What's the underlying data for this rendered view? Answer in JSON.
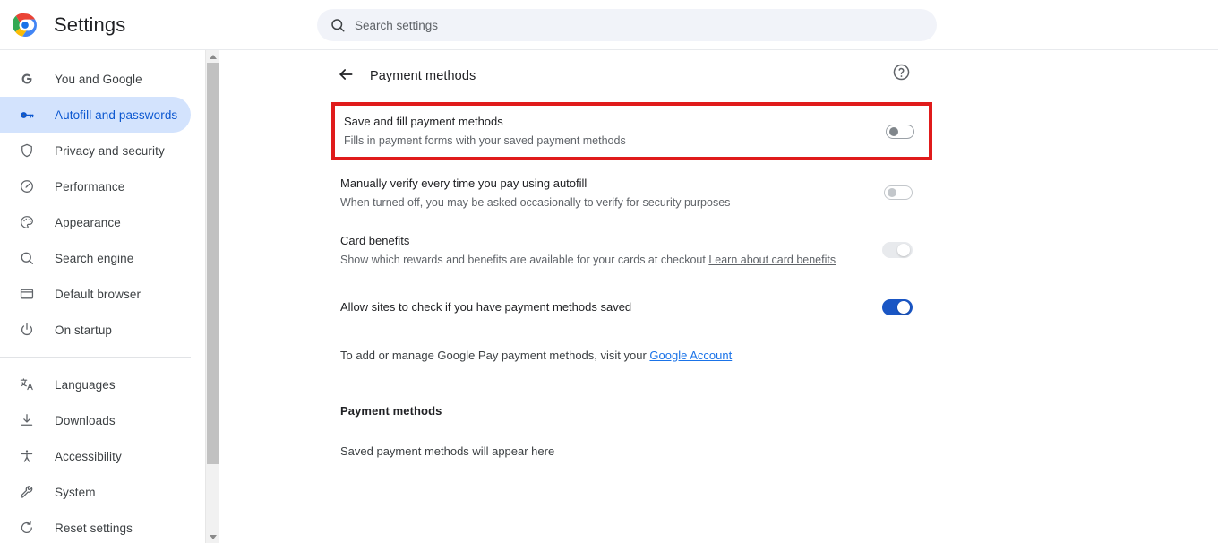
{
  "header": {
    "logo_icon": "chrome-logo-icon",
    "title": "Settings",
    "search": {
      "icon": "search-icon",
      "placeholder": "Search settings",
      "value": ""
    }
  },
  "sidebar": {
    "group1": [
      {
        "icon": "google-g-icon",
        "label": "You and Google",
        "active": false
      },
      {
        "icon": "key-icon",
        "label": "Autofill and passwords",
        "active": true
      },
      {
        "icon": "shield-icon",
        "label": "Privacy and security",
        "active": false
      },
      {
        "icon": "speedometer-icon",
        "label": "Performance",
        "active": false
      },
      {
        "icon": "palette-icon",
        "label": "Appearance",
        "active": false
      },
      {
        "icon": "search-icon",
        "label": "Search engine",
        "active": false
      },
      {
        "icon": "window-icon",
        "label": "Default browser",
        "active": false
      },
      {
        "icon": "power-icon",
        "label": "On startup",
        "active": false
      }
    ],
    "group2": [
      {
        "icon": "translate-icon",
        "label": "Languages",
        "active": false
      },
      {
        "icon": "download-icon",
        "label": "Downloads",
        "active": false
      },
      {
        "icon": "accessibility-icon",
        "label": "Accessibility",
        "active": false
      },
      {
        "icon": "wrench-icon",
        "label": "System",
        "active": false
      },
      {
        "icon": "restore-icon",
        "label": "Reset settings",
        "active": false
      }
    ]
  },
  "main": {
    "back_icon": "back-arrow-icon",
    "title": "Payment methods",
    "help_icon": "help-circle-icon",
    "rows": [
      {
        "title": "Save and fill payment methods",
        "subtitle": "Fills in payment forms with your saved payment methods",
        "toggle_state": "off",
        "highlighted": true
      },
      {
        "title": "Manually verify every time you pay using autofill",
        "subtitle": "When turned off, you may be asked occasionally to verify for security purposes",
        "toggle_state": "off-faded",
        "highlighted": false
      },
      {
        "title": "Card benefits",
        "subtitle": "Show which rewards and benefits are available for your cards at checkout ",
        "subtitle_link": "Learn about card benefits",
        "toggle_state": "on-disabled",
        "highlighted": false
      },
      {
        "title": "Allow sites to check if you have payment methods saved",
        "subtitle": "",
        "toggle_state": "on",
        "highlighted": false
      }
    ],
    "google_pay_note": "To add or manage Google Pay payment methods, visit your ",
    "google_pay_link": "Google Account",
    "section_title": "Payment methods",
    "empty_state": "Saved payment methods will appear here"
  },
  "highlight_color": "#e01b1b",
  "accent_color": "#0b57d0",
  "toggle_on_color": "#1a56c4"
}
